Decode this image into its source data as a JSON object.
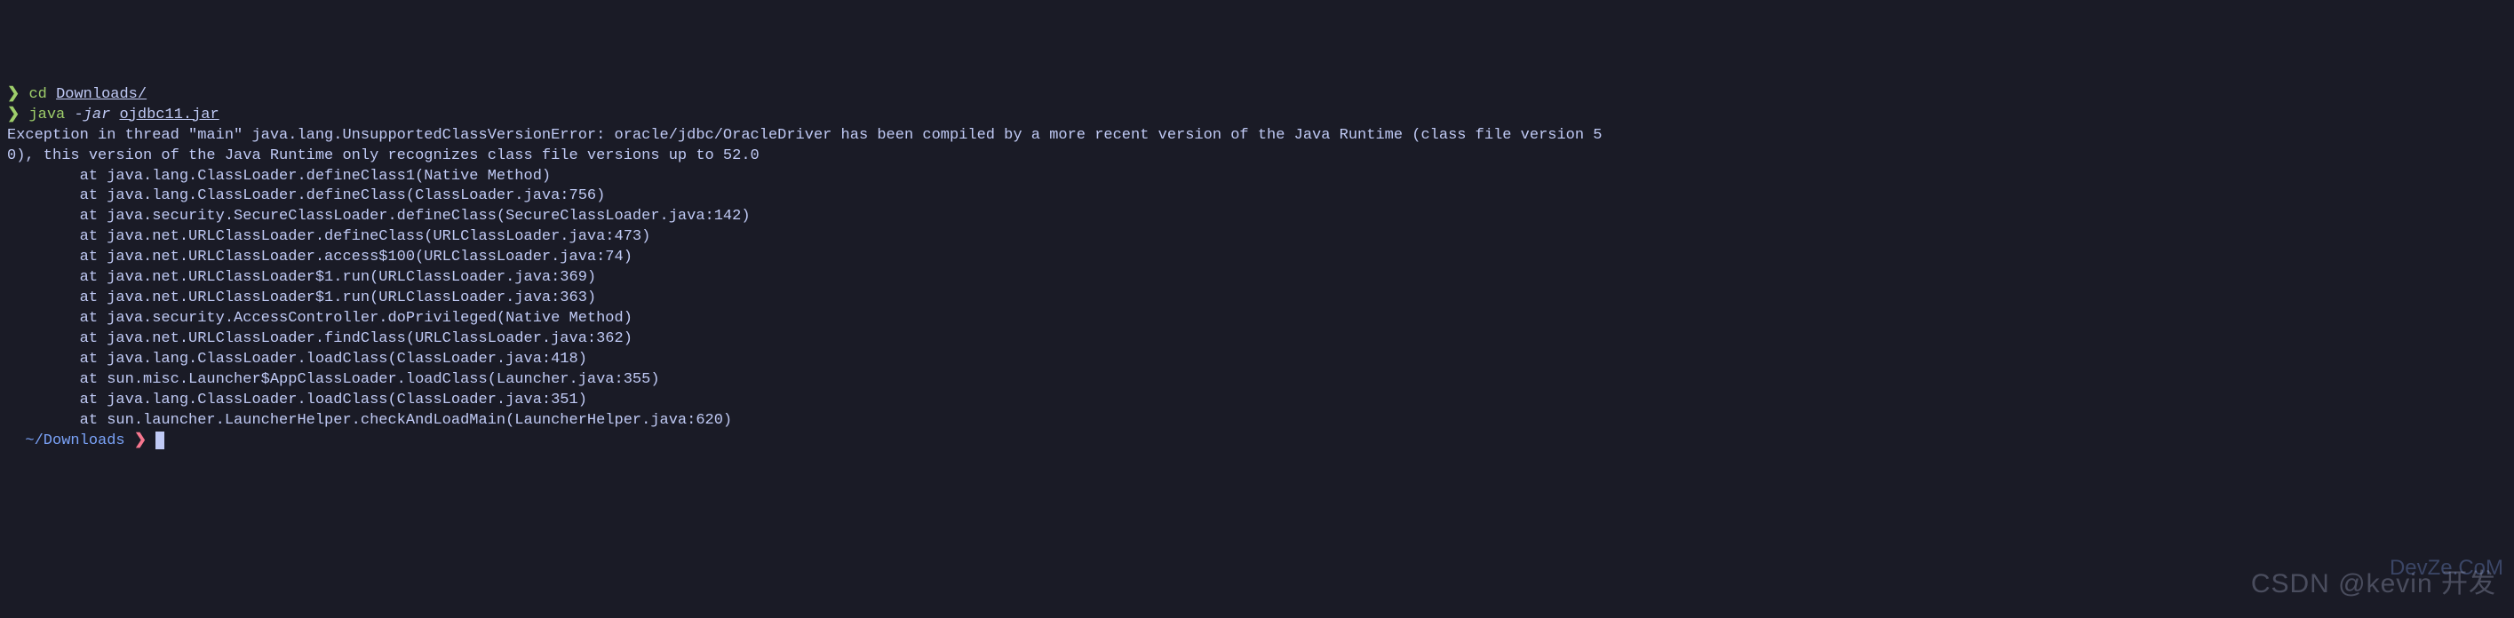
{
  "prompt1": {
    "arrow": "❯",
    "command": "cd",
    "arg": "Downloads/"
  },
  "prompt2": {
    "arrow": "❯",
    "command": "java",
    "flag": "-jar",
    "arg": "ojdbc11.jar"
  },
  "exception_header": "Exception in thread \"main\" java.lang.UnsupportedClassVersionError: oracle/jdbc/OracleDriver has been compiled by a more recent version of the Java Runtime (class file version 5",
  "exception_cont": "0), this version of the Java Runtime only recognizes class file versions up to 52.0",
  "stack": [
    "        at java.lang.ClassLoader.defineClass1(Native Method)",
    "        at java.lang.ClassLoader.defineClass(ClassLoader.java:756)",
    "        at java.security.SecureClassLoader.defineClass(SecureClassLoader.java:142)",
    "        at java.net.URLClassLoader.defineClass(URLClassLoader.java:473)",
    "        at java.net.URLClassLoader.access$100(URLClassLoader.java:74)",
    "        at java.net.URLClassLoader$1.run(URLClassLoader.java:369)",
    "        at java.net.URLClassLoader$1.run(URLClassLoader.java:363)",
    "        at java.security.AccessController.doPrivileged(Native Method)",
    "        at java.net.URLClassLoader.findClass(URLClassLoader.java:362)",
    "        at java.lang.ClassLoader.loadClass(ClassLoader.java:418)",
    "        at sun.misc.Launcher$AppClassLoader.loadClass(Launcher.java:355)",
    "        at java.lang.ClassLoader.loadClass(ClassLoader.java:351)",
    "        at sun.launcher.LauncherHelper.checkAndLoadMain(LauncherHelper.java:620)"
  ],
  "statusline": {
    "apple": "",
    "folder": "",
    "path": "~/Downloads",
    "arrow": "❯"
  },
  "watermark_main": "CSDN @kevin 开发",
  "watermark_sub": "DevZe.CoM"
}
